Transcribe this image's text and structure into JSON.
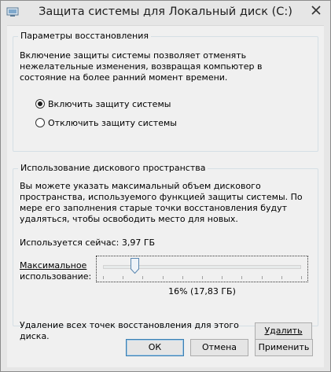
{
  "window": {
    "title": "Защита системы для Локальный диск (C:)"
  },
  "restore_settings": {
    "legend": "Параметры восстановления",
    "description": "Включение защиты системы позволяет отменять нежелательные изменения, возвращая компьютер в состояние на более ранний момент времени.",
    "options": [
      {
        "label": "Включить защиту системы",
        "selected": true
      },
      {
        "label": "Отключить защиту системы",
        "selected": false
      }
    ]
  },
  "disk_usage": {
    "legend": "Использование дискового пространства",
    "description": "Вы можете указать максимальный объем дискового пространства, используемого функцией защиты системы. По мере его заполнения старые точки восстановления будут удаляться, чтобы освободить место для новых.",
    "current_usage": "Используется сейчас: 3,97 ГБ",
    "max_label_line1": "Максимальное",
    "max_label_line2": "использование:",
    "slider_percent": 16,
    "slider_value_text": "16% (17,83 ГБ)"
  },
  "delete_section": {
    "description": "Удаление всех точек восстановления для этого диска.",
    "button_label": "Удалить"
  },
  "buttons": {
    "ok": "ОК",
    "cancel": "Отмена",
    "apply": "Применить"
  },
  "icons": {
    "app": "system-protection-icon",
    "close": "close-icon"
  }
}
